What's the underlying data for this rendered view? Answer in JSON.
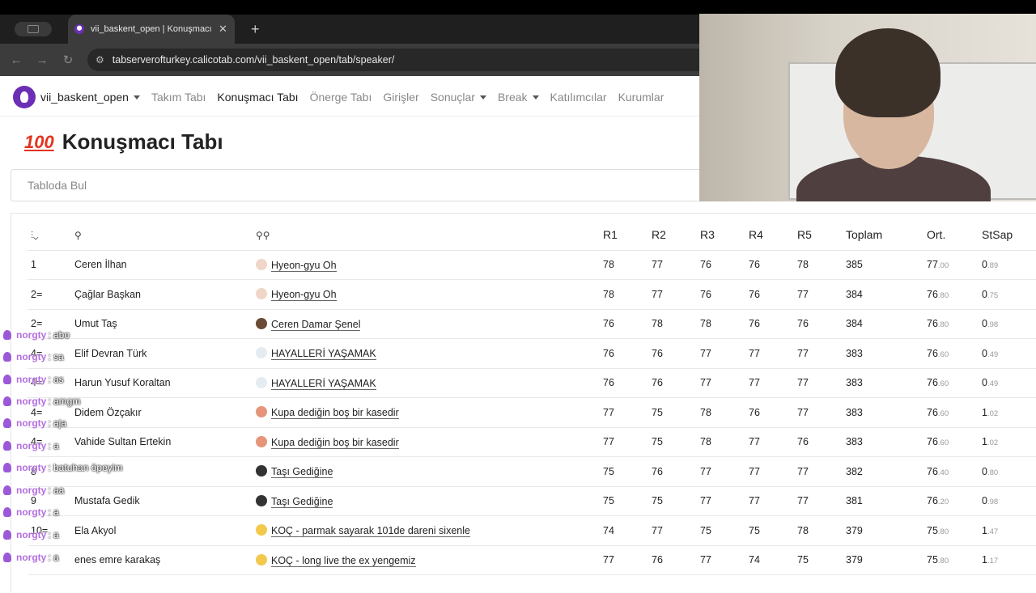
{
  "browser": {
    "tab_title": "vii_baskent_open | Konuşmacı Tabı",
    "url": "tabserverofturkey.calicotab.com/vii_baskent_open/tab/speaker/"
  },
  "navbar": {
    "brand": "vii_baskent_open",
    "items": [
      "Takım Tabı",
      "Konuşmacı Tabı",
      "Önerge Tabı",
      "Girişler",
      "Sonuçlar",
      "Break",
      "Katılımcılar",
      "Kurumlar"
    ]
  },
  "page": {
    "title_icon": "100",
    "title": "Konuşmacı Tabı",
    "search_placeholder": "Tabloda Bul"
  },
  "table": {
    "headers": [
      "R1",
      "R2",
      "R3",
      "R4",
      "R5",
      "Toplam",
      "Ort.",
      "StSap"
    ],
    "rows": [
      {
        "rank": "1",
        "name": "Ceren İlhan",
        "team": "Hyeon-gyu Oh",
        "emoji_color": "#f0d6c8",
        "r": [
          "78",
          "77",
          "76",
          "76",
          "78"
        ],
        "total": "385",
        "avg_int": "77",
        "avg_dec": ".00",
        "sd_int": "0",
        "sd_dec": ".89"
      },
      {
        "rank": "2=",
        "name": "Çağlar Başkan",
        "team": "Hyeon-gyu Oh",
        "emoji_color": "#f0d6c8",
        "r": [
          "78",
          "77",
          "76",
          "76",
          "77"
        ],
        "total": "384",
        "avg_int": "76",
        "avg_dec": ".80",
        "sd_int": "0",
        "sd_dec": ".75"
      },
      {
        "rank": "2=",
        "name": "Umut Taş",
        "team": "Ceren Damar Şenel",
        "emoji_color": "#6b4a36",
        "r": [
          "76",
          "78",
          "78",
          "76",
          "76"
        ],
        "total": "384",
        "avg_int": "76",
        "avg_dec": ".80",
        "sd_int": "0",
        "sd_dec": ".98"
      },
      {
        "rank": "4=",
        "name": "Elif Devran Türk",
        "team": "HAYALLERİ YAŞAMAK",
        "emoji_color": "#e4ecf2",
        "r": [
          "76",
          "76",
          "77",
          "77",
          "77"
        ],
        "total": "383",
        "avg_int": "76",
        "avg_dec": ".60",
        "sd_int": "0",
        "sd_dec": ".49"
      },
      {
        "rank": "4=",
        "name": "Harun Yusuf Koraltan",
        "team": "HAYALLERİ YAŞAMAK",
        "emoji_color": "#e4ecf2",
        "r": [
          "76",
          "76",
          "77",
          "77",
          "77"
        ],
        "total": "383",
        "avg_int": "76",
        "avg_dec": ".60",
        "sd_int": "0",
        "sd_dec": ".49"
      },
      {
        "rank": "4=",
        "name": "Didem Özçakır",
        "team": "Kupa dediğin boş bir kasedir",
        "emoji_color": "#e6957a",
        "r": [
          "77",
          "75",
          "78",
          "76",
          "77"
        ],
        "total": "383",
        "avg_int": "76",
        "avg_dec": ".60",
        "sd_int": "1",
        "sd_dec": ".02"
      },
      {
        "rank": "4=",
        "name": "Vahide Sultan Ertekin",
        "team": "Kupa dediğin boş bir kasedir",
        "emoji_color": "#e6957a",
        "r": [
          "77",
          "75",
          "78",
          "77",
          "76"
        ],
        "total": "383",
        "avg_int": "76",
        "avg_dec": ".60",
        "sd_int": "1",
        "sd_dec": ".02"
      },
      {
        "rank": "8",
        "name": "",
        "team": "Taşı Gediğine",
        "emoji_color": "#333333",
        "r": [
          "75",
          "76",
          "77",
          "77",
          "77"
        ],
        "total": "382",
        "avg_int": "76",
        "avg_dec": ".40",
        "sd_int": "0",
        "sd_dec": ".80"
      },
      {
        "rank": "9",
        "name": "Mustafa Gedik",
        "team": "Taşı Gediğine",
        "emoji_color": "#333333",
        "r": [
          "75",
          "75",
          "77",
          "77",
          "77"
        ],
        "total": "381",
        "avg_int": "76",
        "avg_dec": ".20",
        "sd_int": "0",
        "sd_dec": ".98"
      },
      {
        "rank": "10=",
        "name": "Ela Akyol",
        "team": "KOÇ - parmak sayarak 101de dareni sixenle",
        "emoji_color": "#f2c94c",
        "r": [
          "74",
          "77",
          "75",
          "75",
          "78"
        ],
        "total": "379",
        "avg_int": "75",
        "avg_dec": ".80",
        "sd_int": "1",
        "sd_dec": ".47"
      },
      {
        "rank": "",
        "name": "enes emre karakaş",
        "team": "KOÇ - long live the ex yengemiz",
        "emoji_color": "#f2c94c",
        "r": [
          "77",
          "76",
          "77",
          "74",
          "75"
        ],
        "total": "379",
        "avg_int": "75",
        "avg_dec": ".80",
        "sd_int": "1",
        "sd_dec": ".17"
      }
    ]
  },
  "chat": [
    {
      "user": "norgty",
      "msg": ": abo"
    },
    {
      "user": "norgty",
      "msg": ": sa"
    },
    {
      "user": "norgty",
      "msg": ": as"
    },
    {
      "user": "norgty",
      "msg": ": amgm"
    },
    {
      "user": "norgty",
      "msg": ": aja"
    },
    {
      "user": "norgty",
      "msg": ": a"
    },
    {
      "user": "norgty",
      "msg": ": batuhan öpeyim"
    },
    {
      "user": "norgty",
      "msg": ": aa"
    },
    {
      "user": "norgty",
      "msg": ": a"
    },
    {
      "user": "norgty",
      "msg": ": a"
    },
    {
      "user": "norgty",
      "msg": ": a"
    }
  ]
}
